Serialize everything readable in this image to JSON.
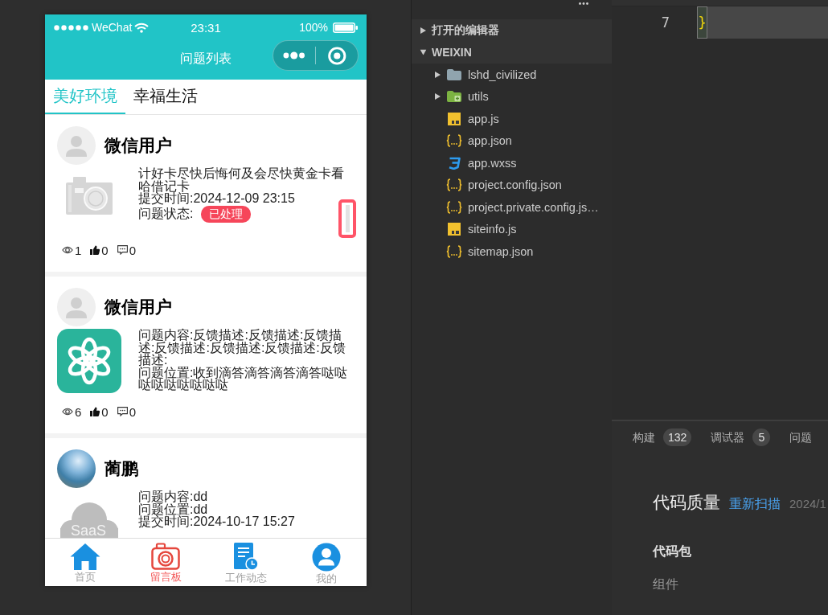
{
  "status_bar": {
    "carrier": "WeChat",
    "time": "23:31",
    "battery": "100%"
  },
  "nav": {
    "title": "问题列表"
  },
  "tabs": [
    {
      "label": "美好环境",
      "selected": true
    },
    {
      "label": "幸福生活",
      "selected": false
    }
  ],
  "posts": [
    {
      "avatar": {
        "kind": "default"
      },
      "user": "微信用户",
      "image": {
        "kind": "camera"
      },
      "lines": [
        {
          "kind": "text",
          "text": "计好卡尽快后悔何及会尽快黄金卡看哈借记卡"
        },
        {
          "kind": "text",
          "text": "提交时间:2024-12-09 23:15"
        },
        {
          "kind": "status",
          "label": "问题状态:",
          "badge": "已处理"
        }
      ],
      "views": "1",
      "likes": "0",
      "comments": "0",
      "marker": true
    },
    {
      "avatar": {
        "kind": "default"
      },
      "user": "微信用户",
      "image": {
        "kind": "logo"
      },
      "lines": [
        {
          "kind": "text",
          "text": "问题内容:反馈描述:反馈描述:反馈描述:反馈描述:反馈描述:反馈描述:反馈描述:"
        },
        {
          "kind": "text",
          "text": "问题位置:收到滴答滴答滴答滴答哒哒哒哒哒哒哒哒哒"
        }
      ],
      "views": "6",
      "likes": "0",
      "comments": "0"
    },
    {
      "avatar": {
        "kind": "photo"
      },
      "user": "蔺鹏",
      "image": {
        "kind": "cloud",
        "text": "SaaS"
      },
      "lines": [
        {
          "kind": "text",
          "text": "问题内容:dd"
        },
        {
          "kind": "text",
          "text": "问题位置:dd"
        },
        {
          "kind": "text",
          "text": "提交时间:2024-10-17 15:27"
        }
      ]
    }
  ],
  "tabbar": [
    {
      "label": "首页",
      "kind": "home",
      "selected": false
    },
    {
      "label": "留言板",
      "kind": "camera",
      "selected": true
    },
    {
      "label": "工作动态",
      "kind": "document",
      "selected": false
    },
    {
      "label": "我的",
      "kind": "person",
      "selected": false
    }
  ],
  "explorer": {
    "sections": [
      {
        "label": "打开的编辑器",
        "expanded": false
      },
      {
        "label": "WEIXIN",
        "expanded": true,
        "children": [
          {
            "name": "lshd_civilized",
            "kind": "folder",
            "expanded": false
          },
          {
            "name": "utils",
            "kind": "folderplus",
            "expanded": false
          },
          {
            "name": "app.js",
            "kind": "js"
          },
          {
            "name": "app.json",
            "kind": "json"
          },
          {
            "name": "app.wxss",
            "kind": "css"
          },
          {
            "name": "project.config.json",
            "kind": "json"
          },
          {
            "name": "project.private.config.js…",
            "kind": "json"
          },
          {
            "name": "siteinfo.js",
            "kind": "js"
          },
          {
            "name": "sitemap.json",
            "kind": "json"
          }
        ]
      }
    ]
  },
  "editor": {
    "lines": [
      {
        "number": "7",
        "code": "}",
        "current": true
      }
    ]
  },
  "panel": {
    "tabs": [
      {
        "label": "构建",
        "badge": "132"
      },
      {
        "label": "调试器",
        "badge": "5"
      },
      {
        "label": "问题"
      }
    ],
    "quality": {
      "title": "代码质量",
      "action": "重新扫描",
      "date": "2024/1",
      "items": [
        {
          "kind": "heading",
          "label": "代码包"
        },
        {
          "kind": "item",
          "label": "组件"
        }
      ]
    }
  }
}
